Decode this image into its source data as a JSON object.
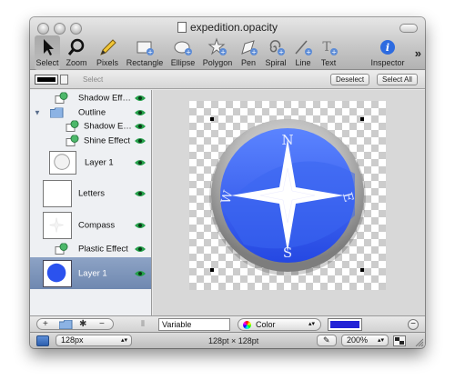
{
  "window": {
    "title": "expedition.opacity"
  },
  "toolbar": {
    "tools": [
      {
        "label": "Select",
        "icon": "arrow-pointer-icon",
        "active": true
      },
      {
        "label": "Zoom",
        "icon": "magnifier-icon"
      },
      {
        "label": "Pixels",
        "icon": "pencil-icon"
      },
      {
        "label": "Rectangle",
        "icon": "rectangle-add-icon"
      },
      {
        "label": "Ellipse",
        "icon": "ellipse-add-icon"
      },
      {
        "label": "Polygon",
        "icon": "star-add-icon"
      },
      {
        "label": "Pen",
        "icon": "pen-add-icon"
      },
      {
        "label": "Spiral",
        "icon": "spiral-add-icon"
      },
      {
        "label": "Line",
        "icon": "line-add-icon"
      },
      {
        "label": "Text",
        "icon": "text-add-icon"
      },
      {
        "label": "Inspector",
        "icon": "info-icon"
      }
    ],
    "overflow": "»"
  },
  "stylebar": {
    "select_label": "Select",
    "deselect": "Deselect",
    "select_all": "Select All"
  },
  "layers": [
    {
      "name": "Shadow Eff…",
      "kind": "effect"
    },
    {
      "name": "Outline",
      "kind": "folder"
    },
    {
      "name": "Shadow E…",
      "kind": "effect"
    },
    {
      "name": "Shine Effect",
      "kind": "effect"
    },
    {
      "name": "Layer 1",
      "kind": "layer"
    },
    {
      "name": "Letters",
      "kind": "layer"
    },
    {
      "name": "Compass",
      "kind": "layer"
    },
    {
      "name": "Plastic Effect",
      "kind": "effect"
    },
    {
      "name": "Layer 1",
      "kind": "layer",
      "selected": true
    }
  ],
  "compass_letters": {
    "n": "N",
    "e": "E",
    "s": "S",
    "w": "W"
  },
  "fillbar": {
    "add": "+",
    "remove": "−",
    "variable": "Variable",
    "color_mode": "Color",
    "color_value": "#2323d6"
  },
  "statusbar": {
    "size": "128px",
    "dimensions": "128pt × 128pt",
    "zoom": "200%"
  },
  "colors": {
    "selection": "#7890b6",
    "compass_blue": "#3a66f0"
  }
}
